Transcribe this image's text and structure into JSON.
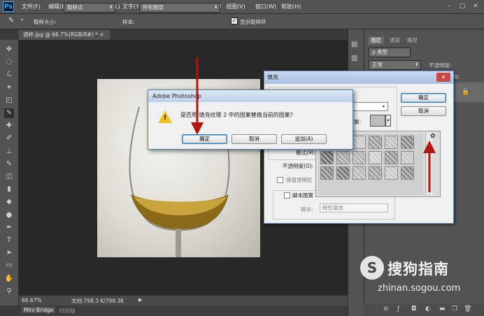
{
  "app": {
    "logo": "Ps"
  },
  "menu": [
    "文件(F)",
    "编辑(E)",
    "图像(I)",
    "图层(L)",
    "文字(Y)",
    "选择(S)",
    "滤镜(T)",
    "3D(D)",
    "视图(V)",
    "窗口(W)",
    "帮助(H)"
  ],
  "window_controls": [
    "–",
    "□",
    "✕"
  ],
  "options": {
    "sample_size_label": "取样大小:",
    "sample_size_value": "取样点",
    "sample_label": "样本:",
    "sample_value": "所有图层",
    "show_ring_label": "显示取样环"
  },
  "document": {
    "tab_title": "酒杯.jpg @ 66.7%(RGB/8#) *",
    "tab_close": "×",
    "zoom": "66.67%",
    "doc_info": "文档:798.3 K/798.3K"
  },
  "bottom_tabs": [
    "Mini Bridge",
    "时间轴"
  ],
  "panel": {
    "tabs": [
      "图层",
      "通道",
      "路径"
    ],
    "filter_value": "ρ 类型",
    "blend_mode": "正常",
    "opacity_label": "不透明度:",
    "fill_label": "填充:",
    "lock_icon": "🔒"
  },
  "fill_dialog": {
    "title": "填充",
    "ok": "确定",
    "cancel": "取消",
    "custom_pattern_label": "案:",
    "mode_label": "模式(M):",
    "opacity_label": "不透明度(O):",
    "preserve_label": "保留透明区",
    "script_label": "脚本图案",
    "script_field_label": "脚本:",
    "script_value": "砖形填充",
    "picker_gear": "✿"
  },
  "alert": {
    "title": "Adobe Photoshop",
    "message": "是否用 填充纹理 2 中的图案替换当前的图案?",
    "ok": "确定",
    "cancel": "取消",
    "append": "追加(A)"
  },
  "watermark": {
    "logo": "S",
    "text": "搜狗指南",
    "url": "zhinan.sogou.com"
  },
  "colors": {
    "arrow": "#b3150f",
    "bg": "#3a3a3a",
    "panel": "#535353"
  }
}
